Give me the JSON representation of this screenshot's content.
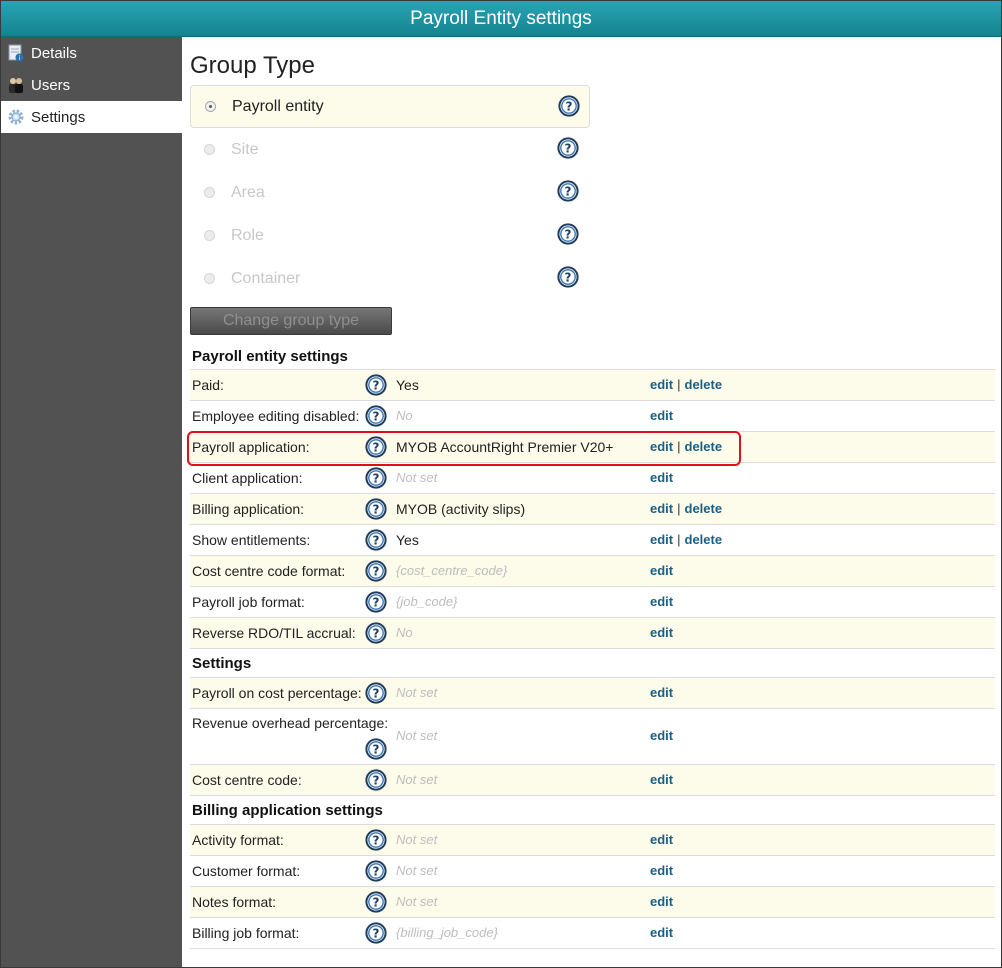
{
  "window": {
    "title": "Payroll Entity settings"
  },
  "sidebar": {
    "items": [
      {
        "label": "Details",
        "icon": "details-icon"
      },
      {
        "label": "Users",
        "icon": "users-icon"
      },
      {
        "label": "Settings",
        "icon": "gear-icon",
        "active": true
      }
    ]
  },
  "group_type": {
    "title": "Group Type",
    "options": [
      {
        "label": "Payroll entity",
        "selected": true
      },
      {
        "label": "Site",
        "selected": false
      },
      {
        "label": "Area",
        "selected": false
      },
      {
        "label": "Role",
        "selected": false
      },
      {
        "label": "Container",
        "selected": false
      }
    ],
    "change_button": "Change group type"
  },
  "actions": {
    "edit": "edit",
    "delete": "delete",
    "separator": "|"
  },
  "sections": [
    {
      "title": "Payroll entity settings",
      "rows": [
        {
          "label": "Paid:",
          "value": "Yes",
          "muted": false,
          "delete": true
        },
        {
          "label": "Employee editing disabled:",
          "value": "No",
          "muted": true,
          "delete": false
        },
        {
          "label": "Payroll application:",
          "value": "MYOB AccountRight Premier V20+",
          "muted": false,
          "delete": true
        },
        {
          "label": "Client application:",
          "value": "Not set",
          "muted": true,
          "delete": false
        },
        {
          "label": "Billing application:",
          "value": "MYOB (activity slips)",
          "muted": false,
          "delete": true
        },
        {
          "label": "Show entitlements:",
          "value": "Yes",
          "muted": false,
          "delete": true
        },
        {
          "label": "Cost centre code format:",
          "value": "{cost_centre_code}",
          "muted": true,
          "delete": false
        },
        {
          "label": "Payroll job format:",
          "value": "{job_code}",
          "muted": true,
          "delete": false
        },
        {
          "label": "Reverse RDO/TIL accrual:",
          "value": "No",
          "muted": true,
          "delete": false
        }
      ]
    },
    {
      "title": "Settings",
      "rows": [
        {
          "label": "Payroll on cost percentage:",
          "value": "Not set",
          "muted": true,
          "delete": false
        },
        {
          "label": "Revenue overhead percentage:",
          "value": "Not set",
          "muted": true,
          "delete": false,
          "tall": true
        },
        {
          "label": "Cost centre code:",
          "value": "Not set",
          "muted": true,
          "delete": false
        }
      ]
    },
    {
      "title": "Billing application settings",
      "rows": [
        {
          "label": "Activity format:",
          "value": "Not set",
          "muted": true,
          "delete": false
        },
        {
          "label": "Customer format:",
          "value": "Not set",
          "muted": true,
          "delete": false
        },
        {
          "label": "Notes format:",
          "value": "Not set",
          "muted": true,
          "delete": false
        },
        {
          "label": "Billing job format:",
          "value": "{billing_job_code}",
          "muted": true,
          "delete": false
        }
      ]
    }
  ],
  "colors": {
    "titlebar": "#1a96a5",
    "sidebar": "#525252",
    "link": "#1b5f85",
    "row_tint": "#fdfbea",
    "highlight": "#e0101a"
  }
}
